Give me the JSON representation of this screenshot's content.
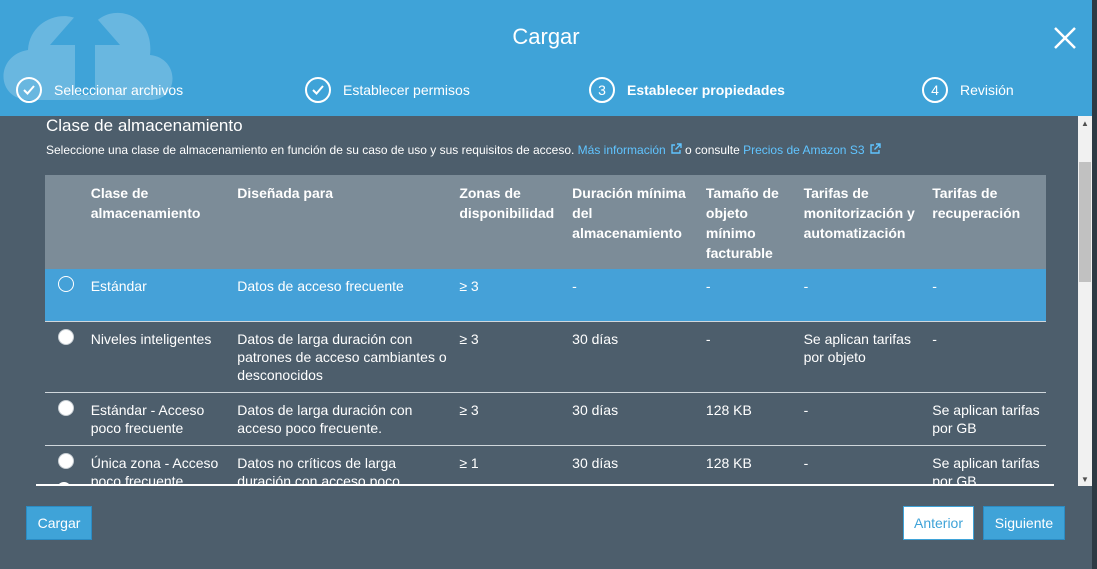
{
  "dialog": {
    "title": "Cargar"
  },
  "steps": [
    {
      "label": "Seleccionar archivos",
      "state": "done",
      "marker": ""
    },
    {
      "label": "Establecer permisos",
      "state": "done",
      "marker": ""
    },
    {
      "label": "Establecer propiedades",
      "state": "current",
      "marker": "3"
    },
    {
      "label": "Revisión",
      "state": "pending",
      "marker": "4"
    }
  ],
  "section": {
    "title": "Clase de almacenamiento",
    "desc_text": "Seleccione una clase de almacenamiento en función de su caso de uso y sus requisitos de acceso.",
    "more_info_link": "Más información",
    "or_text": "o consulte",
    "pricing_link": "Precios de Amazon S3"
  },
  "table": {
    "headers": [
      "Clase de almacenamiento",
      "Diseñada para",
      "Zonas de disponibilidad",
      "Duración mínima del almacenamiento",
      "Tamaño de objeto mínimo facturable",
      "Tarifas de monitorización y automatización",
      "Tarifas de recuperación"
    ],
    "rows": [
      {
        "selected": true,
        "cells": [
          "Estándar",
          "Datos de acceso frecuente",
          "≥ 3",
          "-",
          "-",
          "-",
          "-"
        ]
      },
      {
        "selected": false,
        "cells": [
          "Niveles inteligentes",
          "Datos de larga duración con patrones de acceso cambiantes o desconocidos",
          "≥ 3",
          "30 días",
          "-",
          "Se aplican tarifas por objeto",
          "-"
        ]
      },
      {
        "selected": false,
        "cells": [
          "Estándar - Acceso poco frecuente",
          "Datos de larga duración con acceso poco frecuente.",
          "≥ 3",
          "30 días",
          "128 KB",
          "-",
          "Se aplican tarifas por GB"
        ]
      },
      {
        "selected": false,
        "cells": [
          "Única zona - Acceso poco frecuente",
          "Datos no críticos de larga duración con acceso poco frecuente",
          "≥ 1",
          "30 días",
          "128 KB",
          "-",
          "Se aplican tarifas por GB"
        ]
      }
    ]
  },
  "buttons": {
    "upload": "Cargar",
    "previous": "Anterior",
    "next": "Siguiente"
  },
  "colors": {
    "header_bg": "#3fa3d8",
    "body_bg": "#4d5e6c",
    "table_header_bg": "#7c8c98",
    "selected_row_bg": "#45a1d8",
    "link": "#60c4ff"
  },
  "icons": {
    "close": "close-icon",
    "check": "check-icon",
    "external": "external-link-icon",
    "cloud_upload": "cloud-upload-icon"
  }
}
